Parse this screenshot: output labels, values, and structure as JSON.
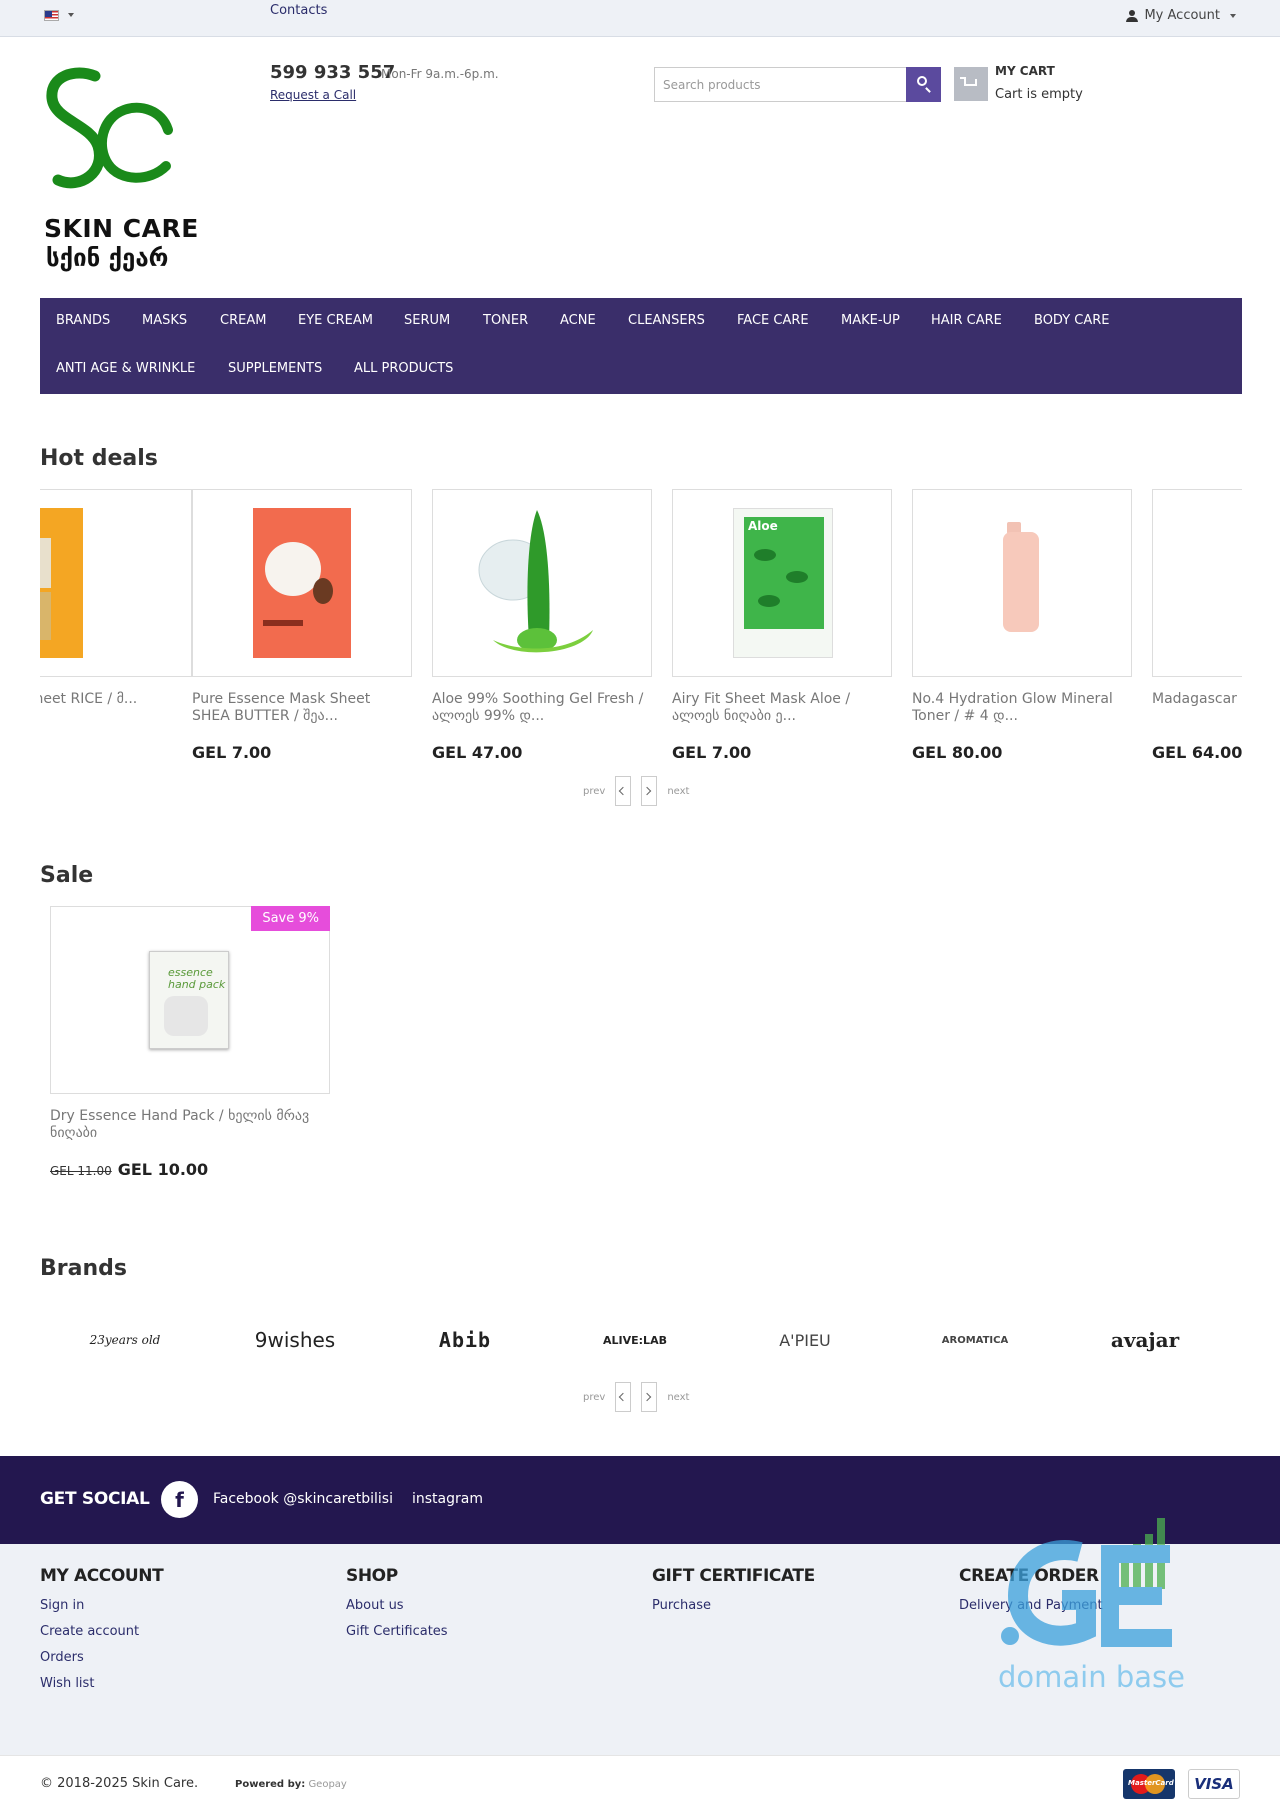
{
  "topbar": {
    "contacts": "Contacts",
    "account": "My Account"
  },
  "header": {
    "logo_line1": "SKIN CARE",
    "logo_line2": "სქინ ქეარ",
    "phone": "599 933 557",
    "hours": "Mon-Fr 9a.m.-6p.m.",
    "request_call": "Request a Call",
    "search_placeholder": "Search products",
    "cart_title": "MY CART",
    "cart_status": "Cart is empty"
  },
  "nav": {
    "row1": [
      "BRANDS",
      "MASKS",
      "CREAM",
      "EYE CREAM",
      "SERUM",
      "TONER",
      "ACNE",
      "CLEANSERS",
      "FACE CARE",
      "MAKE-UP",
      "HAIR CARE",
      "BODY CARE"
    ],
    "row2": [
      "ANTI AGE & WRINKLE",
      "SUPPLEMENTS",
      "ALL PRODUCTS"
    ]
  },
  "hot_deals": {
    "title": "Hot deals",
    "products": [
      {
        "name": "e Mask Sheet RICE / მ...",
        "price": "",
        "image": "rice-mask"
      },
      {
        "name": "Pure Essence Mask Sheet SHEA BUTTER / შეა...",
        "price": "GEL 7.00",
        "image": "shea-mask"
      },
      {
        "name": "Aloe 99% Soothing Gel Fresh / ალოეს 99% დ...",
        "price": "GEL 47.00",
        "image": "aloe-gel"
      },
      {
        "name": "Airy Fit Sheet Mask Aloe / ალოეს ნიღაბი ე...",
        "price": "GEL 7.00",
        "image": "aloe-mask"
      },
      {
        "name": "No.4 Hydration Glow Mineral Toner / # 4 დ...",
        "price": "GEL 80.00",
        "image": "toner-bottle"
      },
      {
        "name": "Madagascar Foam / მადა",
        "price": "GEL 64.00",
        "image": "foam"
      }
    ],
    "pager_prev": "prev",
    "pager_next": "next"
  },
  "sale": {
    "title": "Sale",
    "badge": "Save 9%",
    "product_name": "Dry Essence Hand Pack / ხელის მრავ ნიღაბი",
    "old_price": "GEL 11.00",
    "new_price": "GEL 10.00"
  },
  "brands": {
    "title": "Brands",
    "items": [
      "23years old",
      "9wishes",
      "Abib",
      "ALIVE:LAB",
      "A'PIEU",
      "AROMATICA",
      "avajar"
    ],
    "pager_prev": "prev",
    "pager_next": "next"
  },
  "social": {
    "title": "GET SOCIAL",
    "facebook": "Facebook @skincaretbilisi",
    "instagram": "instagram"
  },
  "footer": {
    "my_account": {
      "title": "MY ACCOUNT",
      "links": [
        "Sign in",
        "Create account",
        "Orders",
        "Wish list"
      ]
    },
    "shop": {
      "title": "SHOP",
      "links": [
        "About us",
        "Gift Certificates"
      ]
    },
    "gift": {
      "title": "GIFT CERTIFICATE",
      "links": [
        "Purchase"
      ]
    },
    "order": {
      "title": "CREATE ORDER",
      "links": [
        "Delivery and Payment"
      ]
    },
    "watermark_text": "domain base",
    "watermark_logo": ".GE",
    "copyright": "© 2018-2025 Skin Care.",
    "powered_label": "Powered by:",
    "powered_by": "Geopay",
    "payment": [
      "MasterCard",
      "VISA"
    ]
  },
  "colors": {
    "nav_bg": "#3a2e6a",
    "social_bg": "#23174f",
    "accent": "#5b4a9e",
    "badge": "#e64ddb",
    "logo_green": "#1a8a1a"
  }
}
